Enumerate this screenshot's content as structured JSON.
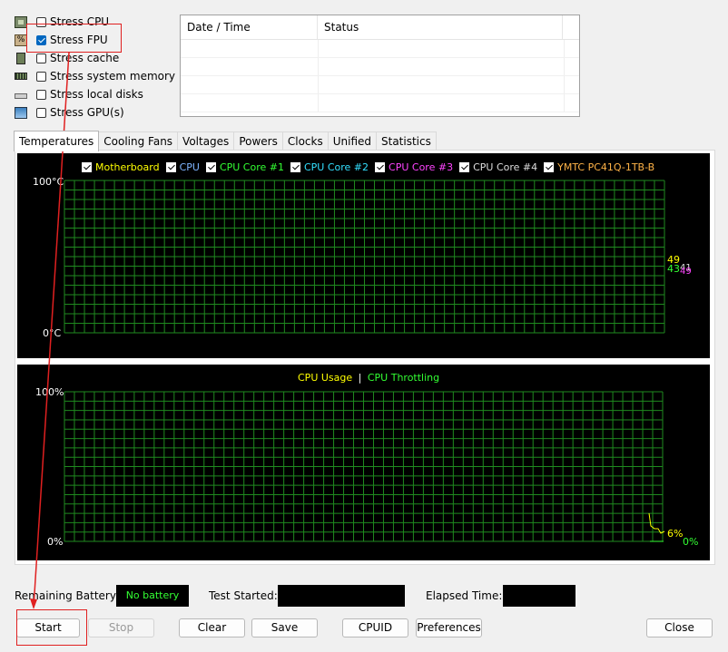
{
  "stress_options": [
    {
      "label": "Stress CPU",
      "checked": false,
      "icon": "cpu-chip-icon"
    },
    {
      "label": "Stress FPU",
      "checked": true,
      "icon": "fpu-icon"
    },
    {
      "label": "Stress cache",
      "checked": false,
      "icon": "cache-icon"
    },
    {
      "label": "Stress system memory",
      "checked": false,
      "icon": "memory-icon"
    },
    {
      "label": "Stress local disks",
      "checked": false,
      "icon": "disk-icon"
    },
    {
      "label": "Stress GPU(s)",
      "checked": false,
      "icon": "gpu-monitor-icon"
    }
  ],
  "log_table": {
    "columns": [
      "Date / Time",
      "Status"
    ],
    "rows": []
  },
  "tabs": [
    "Temperatures",
    "Cooling Fans",
    "Voltages",
    "Powers",
    "Clocks",
    "Unified",
    "Statistics"
  ],
  "active_tab": "Temperatures",
  "temperature_graph": {
    "legend": [
      {
        "label": "Motherboard",
        "color": "#ffff00",
        "checked": true
      },
      {
        "label": "CPU",
        "color": "#7fb5ff",
        "checked": true
      },
      {
        "label": "CPU Core #1",
        "color": "#33ff33",
        "checked": true
      },
      {
        "label": "CPU Core #2",
        "color": "#33e0ff",
        "checked": true
      },
      {
        "label": "CPU Core #3",
        "color": "#ff44ff",
        "checked": true
      },
      {
        "label": "CPU Core #4",
        "color": "#dddddd",
        "checked": true
      },
      {
        "label": "YMTC PC41Q-1TB-B",
        "color": "#ffb347",
        "checked": true
      }
    ],
    "y_max_label": "100°C",
    "y_min_label": "0°C",
    "readouts": [
      {
        "text": "49",
        "color": "#ffff00"
      },
      {
        "text": "43",
        "color": "#33ff33"
      },
      {
        "text": "41",
        "color": "#dddddd"
      },
      {
        "text": "49",
        "color": "#ff44ff"
      }
    ]
  },
  "usage_graph": {
    "title_usage": "CPU Usage",
    "title_sep": "|",
    "title_throttling": "CPU Throttling",
    "usage_color": "#ffff00",
    "throttling_color": "#33ff33",
    "y_max_label": "100%",
    "y_min_label": "0%",
    "usage_value": "6%",
    "throttling_value": "0%"
  },
  "status_bar": {
    "battery_label": "Remaining Battery:",
    "battery_value": "No battery",
    "test_started_label": "Test Started:",
    "test_started_value": "",
    "elapsed_label": "Elapsed Time:",
    "elapsed_value": ""
  },
  "buttons": {
    "start": "Start",
    "stop": "Stop",
    "clear": "Clear",
    "save": "Save",
    "cpuid": "CPUID",
    "preferences": "Preferences",
    "close": "Close"
  },
  "annotation_color": "#e02020"
}
